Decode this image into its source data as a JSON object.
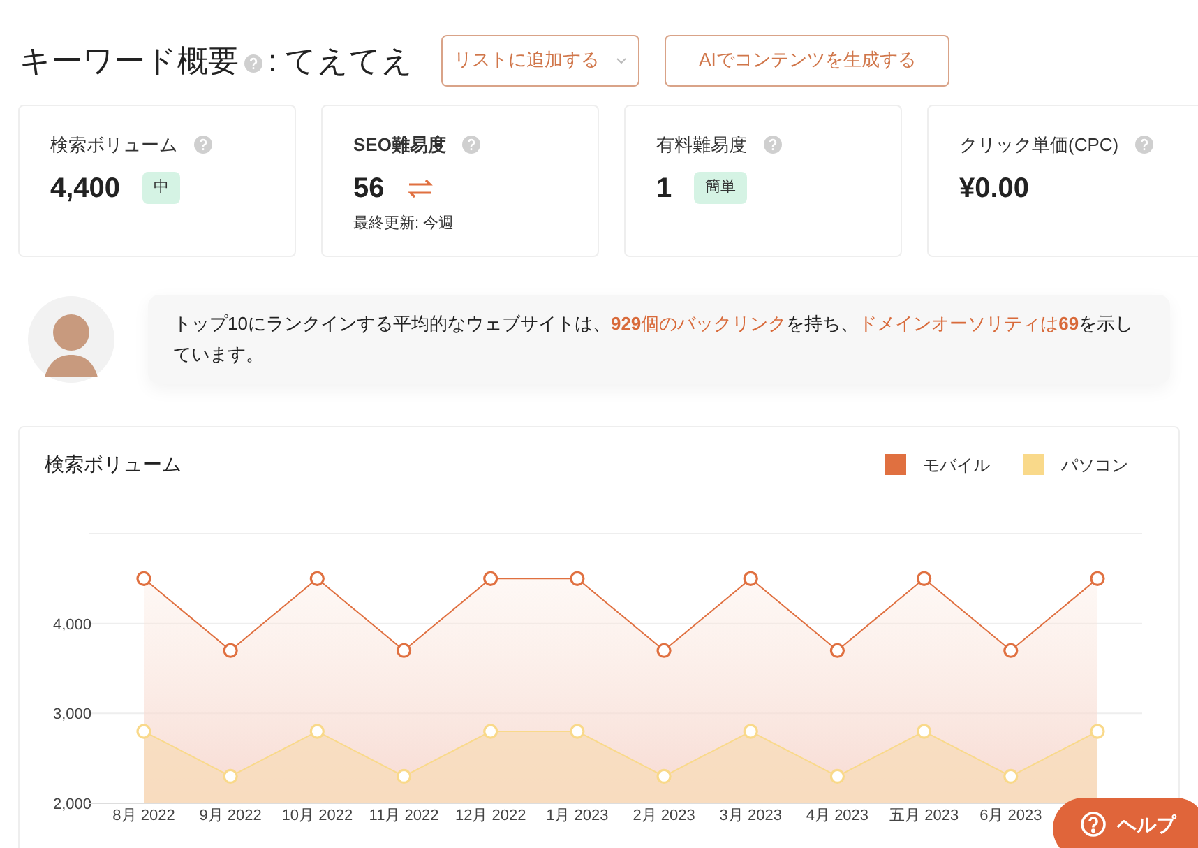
{
  "header": {
    "title": "キーワード概要",
    "keyword": ": てえてえ",
    "add_to_list": "リストに追加する",
    "generate": "AIでコンテンツを生成する"
  },
  "metrics": [
    {
      "kind": "badge",
      "label": "検索ボリューム",
      "value": "4,400",
      "badge": "中"
    },
    {
      "kind": "refresh",
      "label": "SEO難易度",
      "value": "56",
      "note": "最終更新: 今週"
    },
    {
      "kind": "badge",
      "label": "有料難易度",
      "value": "1",
      "badge": "簡単"
    },
    {
      "kind": "plain",
      "label": "クリック単価(CPC)",
      "value": "¥0.00"
    }
  ],
  "insight": {
    "link_1": "**929**個のバックリンク",
    "link_2": "ドメインオーソリティは**69**",
    "before": "トップ10にランクインする平均的なウェブサイトは、",
    "middle": "を持ち、",
    "after": "を示しています。"
  },
  "volume_chart": {
    "title": "検索ボリューム",
    "chart_data": {
      "type": "area",
      "categories": [
        "8月 2022",
        "9月 2022",
        "10月 2022",
        "11月 2022",
        "12月 2022",
        "1月 2023",
        "2月 2023",
        "3月 2023",
        "4月 2023",
        "五月 2023",
        "6月 2023",
        null
      ],
      "ylim": [
        2000,
        5000
      ],
      "yticks": [
        {
          "value": 2000,
          "label": "2,000"
        },
        {
          "value": 3000,
          "label": "3,000"
        },
        {
          "value": 4000,
          "label": "4,000"
        }
      ],
      "series": [
        {
          "name": "モバイル",
          "color": "#e07040",
          "values": [
            4500,
            3700,
            4500,
            3700,
            4500,
            4500,
            3700,
            4500,
            3700,
            4500,
            3700,
            4500
          ]
        },
        {
          "name": "パソコン",
          "color": "#f9d98a",
          "values": [
            2800,
            2300,
            2800,
            2300,
            2800,
            2800,
            2300,
            2800,
            2300,
            2800,
            2300,
            2800
          ]
        }
      ]
    }
  },
  "help": {
    "label": "ヘルプ"
  }
}
